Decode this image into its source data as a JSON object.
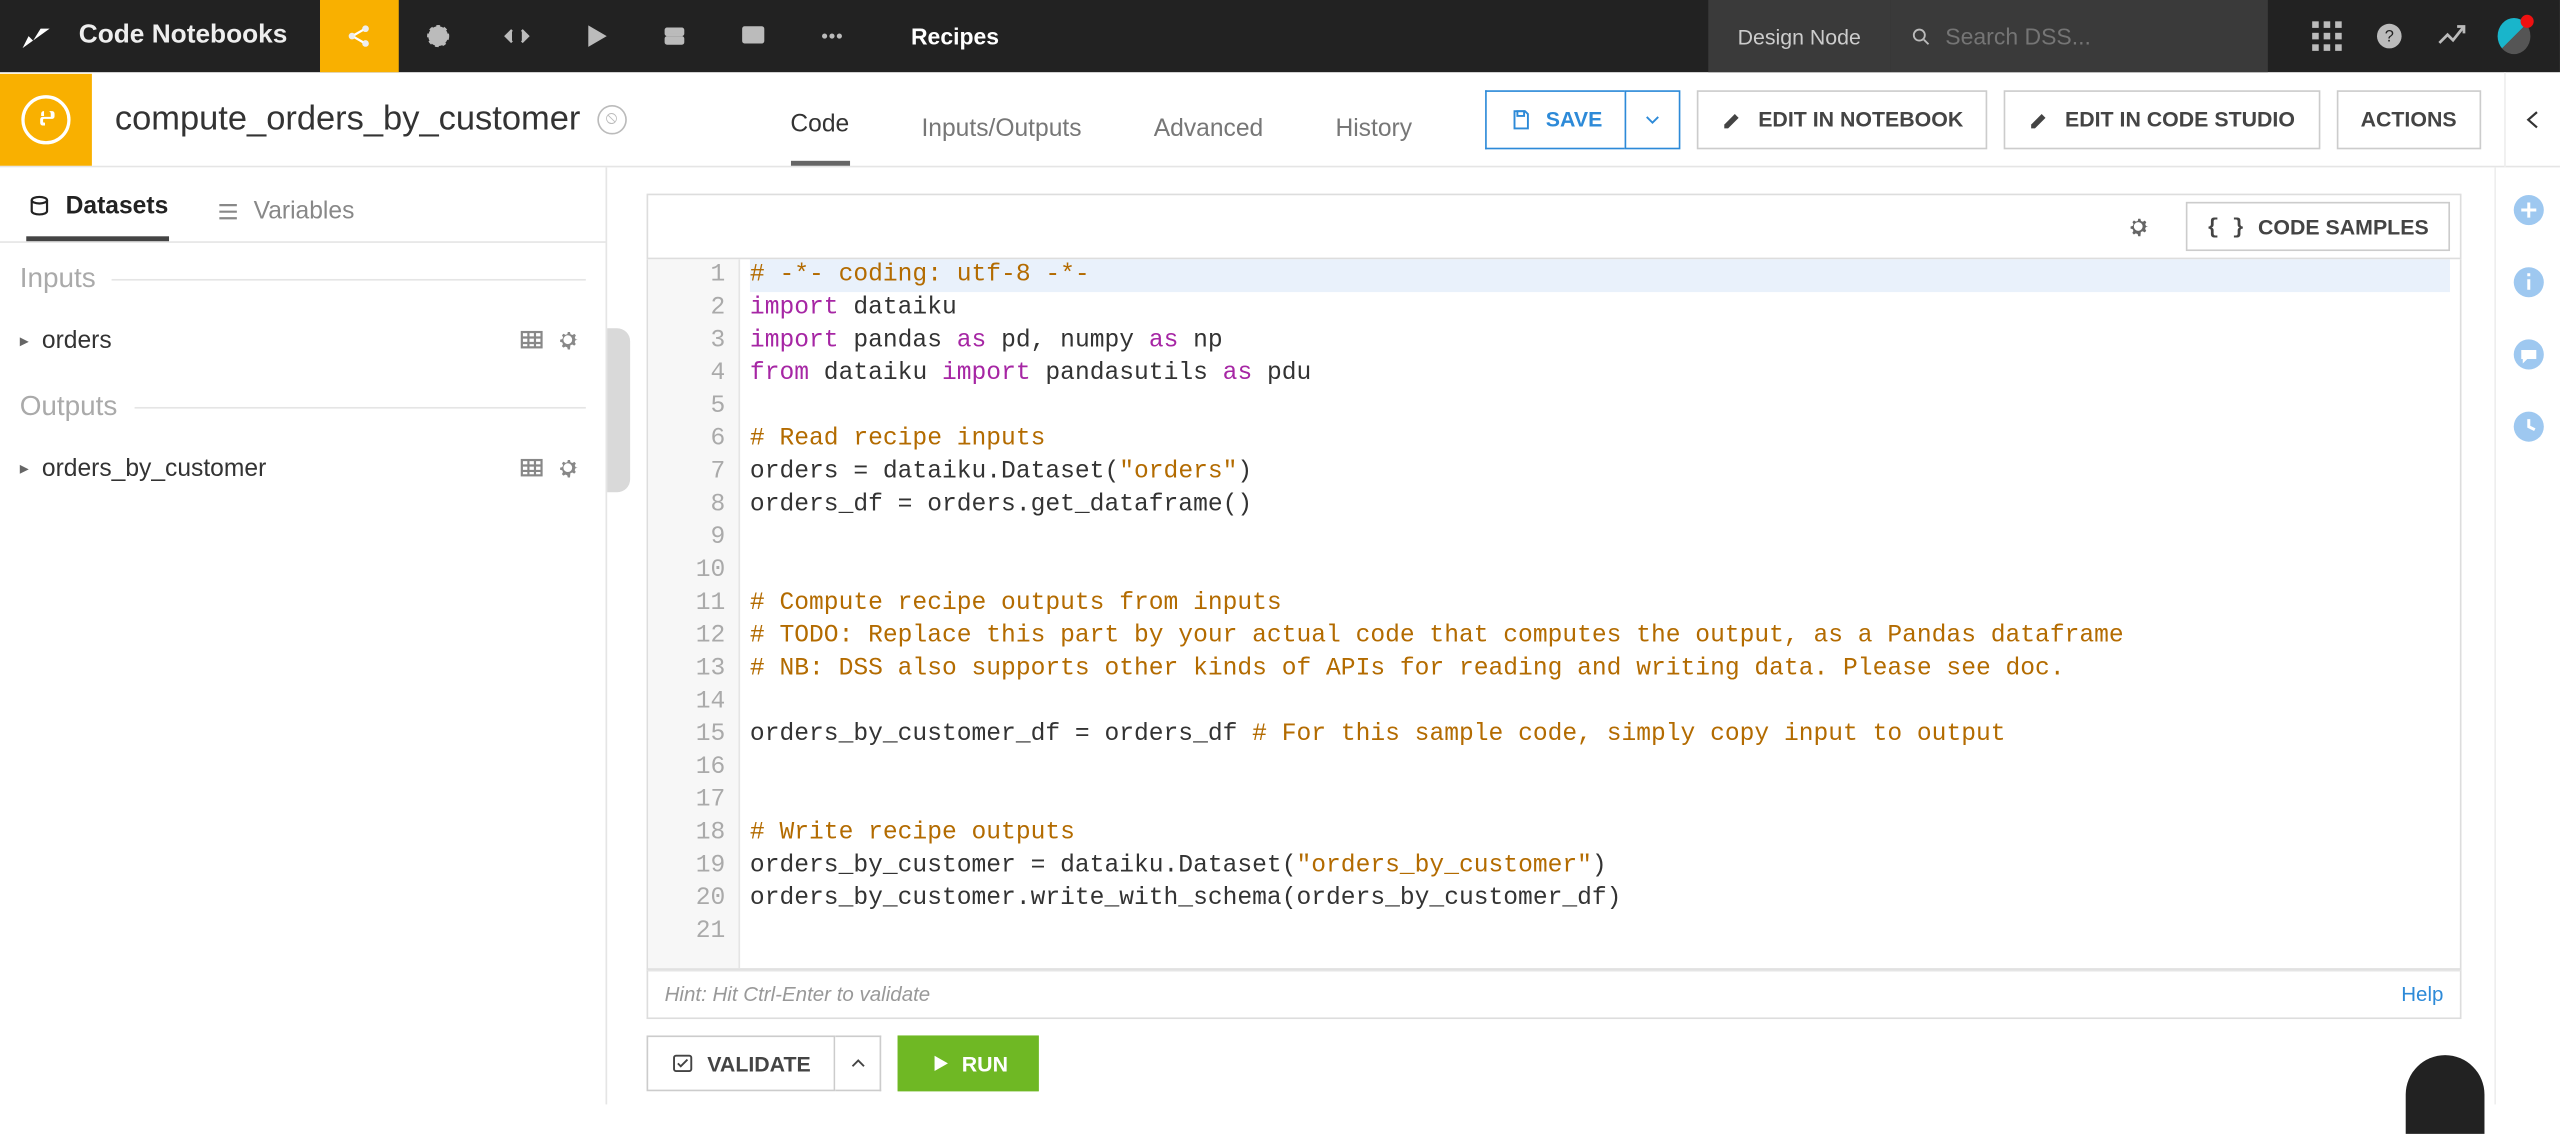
{
  "topbar": {
    "title": "Code Notebooks",
    "active_tab": "Recipes",
    "design_node": "Design Node",
    "search_placeholder": "Search DSS..."
  },
  "secondbar": {
    "recipe_name": "compute_orders_by_customer",
    "tabs": [
      "Code",
      "Inputs/Outputs",
      "Advanced",
      "History"
    ],
    "active_tab": "Code",
    "save_label": "SAVE",
    "edit_notebook": "EDIT IN NOTEBOOK",
    "edit_codestudio": "EDIT IN CODE STUDIO",
    "actions": "ACTIONS"
  },
  "leftpanel": {
    "tabs": {
      "datasets": "Datasets",
      "variables": "Variables"
    },
    "inputs_title": "Inputs",
    "outputs_title": "Outputs",
    "inputs": [
      "orders"
    ],
    "outputs": [
      "orders_by_customer"
    ]
  },
  "editor": {
    "code_samples": "CODE SAMPLES",
    "hint": "Hint: Hit Ctrl-Enter to validate",
    "help": "Help",
    "code": [
      {
        "n": 1,
        "hl": true,
        "seg": [
          {
            "c": "c-comment",
            "t": "# -*- coding: utf-8 -*-"
          }
        ]
      },
      {
        "n": 2,
        "seg": [
          {
            "c": "c-keyword",
            "t": "import"
          },
          {
            "c": "c-text",
            "t": " dataiku"
          }
        ]
      },
      {
        "n": 3,
        "seg": [
          {
            "c": "c-keyword",
            "t": "import"
          },
          {
            "c": "c-text",
            "t": " pandas "
          },
          {
            "c": "c-opkey",
            "t": "as"
          },
          {
            "c": "c-text",
            "t": " pd, numpy "
          },
          {
            "c": "c-opkey",
            "t": "as"
          },
          {
            "c": "c-text",
            "t": " np"
          }
        ]
      },
      {
        "n": 4,
        "seg": [
          {
            "c": "c-keyword",
            "t": "from"
          },
          {
            "c": "c-text",
            "t": " dataiku "
          },
          {
            "c": "c-keyword",
            "t": "import"
          },
          {
            "c": "c-text",
            "t": " pandasutils "
          },
          {
            "c": "c-opkey",
            "t": "as"
          },
          {
            "c": "c-text",
            "t": " pdu"
          }
        ]
      },
      {
        "n": 5,
        "seg": []
      },
      {
        "n": 6,
        "seg": [
          {
            "c": "c-comment",
            "t": "# Read recipe inputs"
          }
        ]
      },
      {
        "n": 7,
        "seg": [
          {
            "c": "c-text",
            "t": "orders = dataiku.Dataset("
          },
          {
            "c": "c-string",
            "t": "\"orders\""
          },
          {
            "c": "c-text",
            "t": ")"
          }
        ]
      },
      {
        "n": 8,
        "seg": [
          {
            "c": "c-text",
            "t": "orders_df = orders.get_dataframe()"
          }
        ]
      },
      {
        "n": 9,
        "seg": []
      },
      {
        "n": 10,
        "seg": []
      },
      {
        "n": 11,
        "seg": [
          {
            "c": "c-comment",
            "t": "# Compute recipe outputs from inputs"
          }
        ]
      },
      {
        "n": 12,
        "seg": [
          {
            "c": "c-comment",
            "t": "# TODO: Replace this part by your actual code that computes the output, as a Pandas dataframe"
          }
        ]
      },
      {
        "n": 13,
        "seg": [
          {
            "c": "c-comment",
            "t": "# NB: DSS also supports other kinds of APIs for reading and writing data. Please see doc."
          }
        ]
      },
      {
        "n": 14,
        "seg": []
      },
      {
        "n": 15,
        "seg": [
          {
            "c": "c-text",
            "t": "orders_by_customer_df = orders_df "
          },
          {
            "c": "c-comment",
            "t": "# For this sample code, simply copy input to output"
          }
        ]
      },
      {
        "n": 16,
        "seg": []
      },
      {
        "n": 17,
        "seg": []
      },
      {
        "n": 18,
        "seg": [
          {
            "c": "c-comment",
            "t": "# Write recipe outputs"
          }
        ]
      },
      {
        "n": 19,
        "seg": [
          {
            "c": "c-text",
            "t": "orders_by_customer = dataiku.Dataset("
          },
          {
            "c": "c-string",
            "t": "\"orders_by_customer\""
          },
          {
            "c": "c-text",
            "t": ")"
          }
        ]
      },
      {
        "n": 20,
        "seg": [
          {
            "c": "c-text",
            "t": "orders_by_customer.write_with_schema(orders_by_customer_df)"
          }
        ]
      },
      {
        "n": 21,
        "seg": []
      }
    ]
  },
  "bottombar": {
    "validate": "VALIDATE",
    "run": "RUN"
  }
}
